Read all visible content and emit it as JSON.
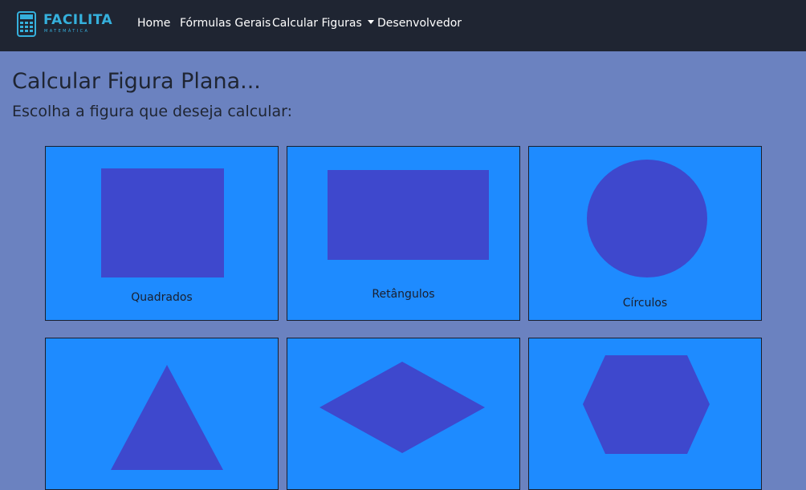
{
  "navbar": {
    "brand": {
      "title": "FACILITA",
      "subtitle": "MATEMÁTICA",
      "icon": "calculator-icon"
    },
    "links": [
      {
        "label": "Home"
      },
      {
        "label": "Fórmulas Gerais"
      },
      {
        "label": "Calcular Figuras",
        "has_dropdown": true
      },
      {
        "label": "Desenvolvedor"
      }
    ]
  },
  "main": {
    "title": "Calcular Figura Plana...",
    "subtitle": "Escolha a figura que deseja calcular:"
  },
  "cards": [
    {
      "label": "Quadrados",
      "shape": "square-icon"
    },
    {
      "label": "Retângulos",
      "shape": "rectangle-icon"
    },
    {
      "label": "Círculos",
      "shape": "circle-icon"
    },
    {
      "label": "",
      "shape": "triangle-icon"
    },
    {
      "label": "",
      "shape": "rhombus-icon"
    },
    {
      "label": "",
      "shape": "hexagon-icon"
    }
  ],
  "colors": {
    "navbar_bg": "#1f2532",
    "page_bg": "#6b82c0",
    "brand_accent": "#35b0dc",
    "card_bg": "#1e8bff",
    "shape_fill": "#3e48cd"
  }
}
